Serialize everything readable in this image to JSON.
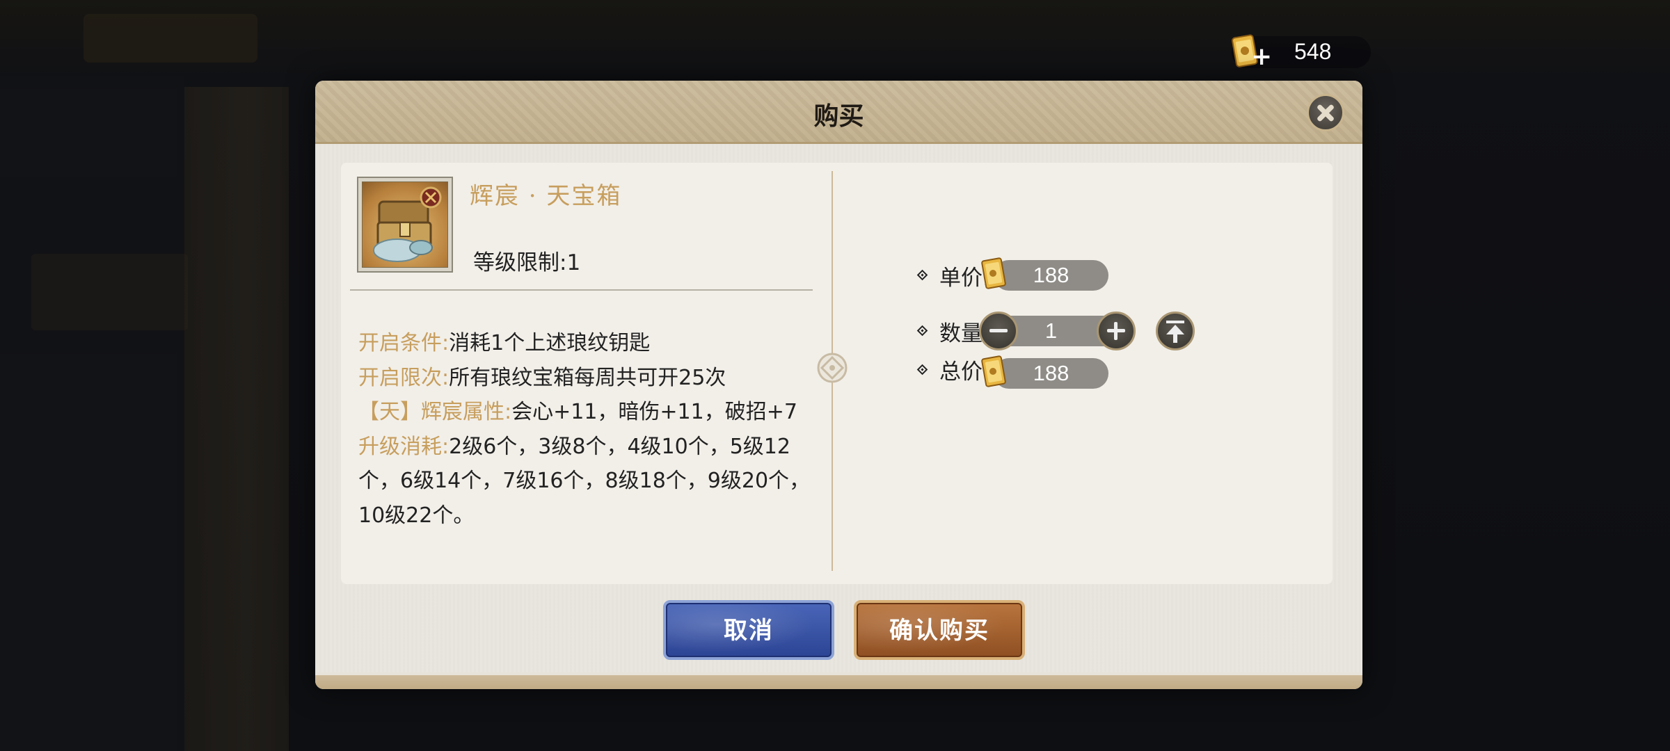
{
  "currency": {
    "amount": "548",
    "plus_label": "+"
  },
  "dialog": {
    "title": "购买",
    "item": {
      "name": "辉宸 · 天宝箱",
      "level_limit": "等级限制:1"
    },
    "description": {
      "open_condition_label": "开启条件:",
      "open_condition_value": "消耗1个上述琅纹钥匙",
      "open_limit_label": "开启限次:",
      "open_limit_value": "所有琅纹宝箱每周共可开25次",
      "attr_label": "【天】辉宸属性:",
      "attr_value": "会心+11，暗伤+11，破招+7",
      "upgrade_label": "升级消耗:",
      "upgrade_value": "2级6个，3级8个，4级10个，5级12个，6级14个，7级16个，8级18个，9级20个，10级22个。"
    },
    "purchase": {
      "unit_price_label": "单价:",
      "unit_price": "188",
      "quantity_label": "数量:",
      "quantity": "1",
      "total_label": "总价:",
      "total_price": "188"
    },
    "buttons": {
      "cancel": "取消",
      "confirm": "确认购买"
    }
  },
  "colors": {
    "accent_gold": "#c79e5d",
    "cancel_blue": "#2c4494",
    "confirm_brown": "#8f4f22"
  }
}
